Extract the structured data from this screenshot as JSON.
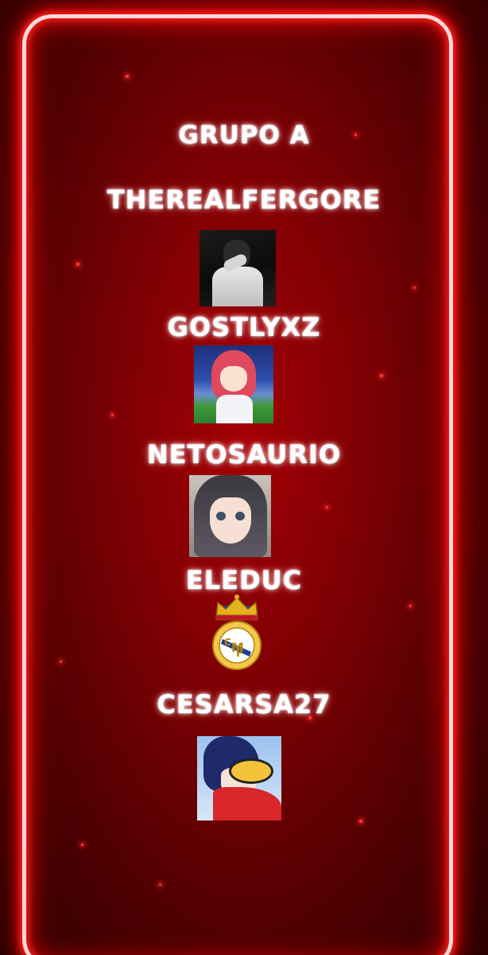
{
  "group": {
    "title": "GRUPO A"
  },
  "players": [
    {
      "name": "THEREALFERGORE",
      "avatar_icon": "avatar-image"
    },
    {
      "name": "GOSTLYXZ",
      "avatar_icon": "avatar-image"
    },
    {
      "name": "NETOSAURIO",
      "avatar_icon": "avatar-image"
    },
    {
      "name": "ELEDUC",
      "avatar_icon": "real-madrid-crest"
    },
    {
      "name": "CESARSA27",
      "avatar_icon": "avatar-image"
    }
  ],
  "colors": {
    "background": "#7e0004",
    "neon_frame": "#ff2020",
    "text": "#ffffff"
  }
}
